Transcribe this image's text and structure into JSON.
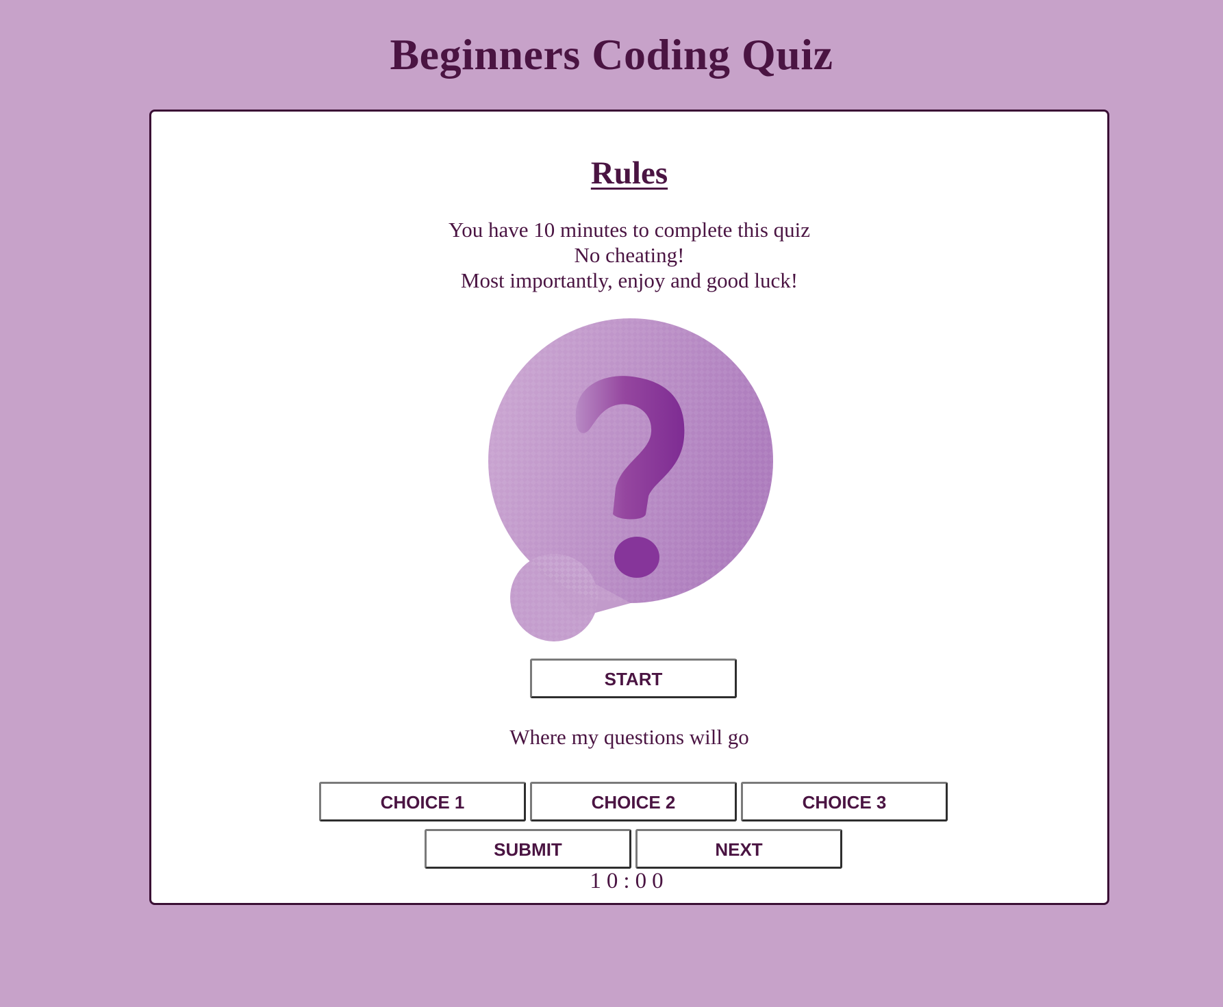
{
  "header": {
    "title": "Beginners Coding Quiz"
  },
  "rules": {
    "heading": "Rules",
    "lines": [
      "You have 10 minutes to complete this quiz",
      "No cheating!",
      "Most importantly, enjoy and good luck!"
    ]
  },
  "quiz": {
    "image_icon": "question-mark-bubble-icon",
    "start_label": "START",
    "question": "Where my questions will go",
    "choices": [
      "CHOICE 1",
      "CHOICE 2",
      "CHOICE 3"
    ],
    "submit_label": "SUBMIT",
    "next_label": "NEXT",
    "timer": "10:00"
  },
  "colors": {
    "background": "#c7a2c9",
    "text": "#4a1442",
    "card": "#ffffff",
    "card_border": "#3a0f34",
    "icon_fill": "#b98cc2",
    "icon_glyph": "#86359a"
  }
}
